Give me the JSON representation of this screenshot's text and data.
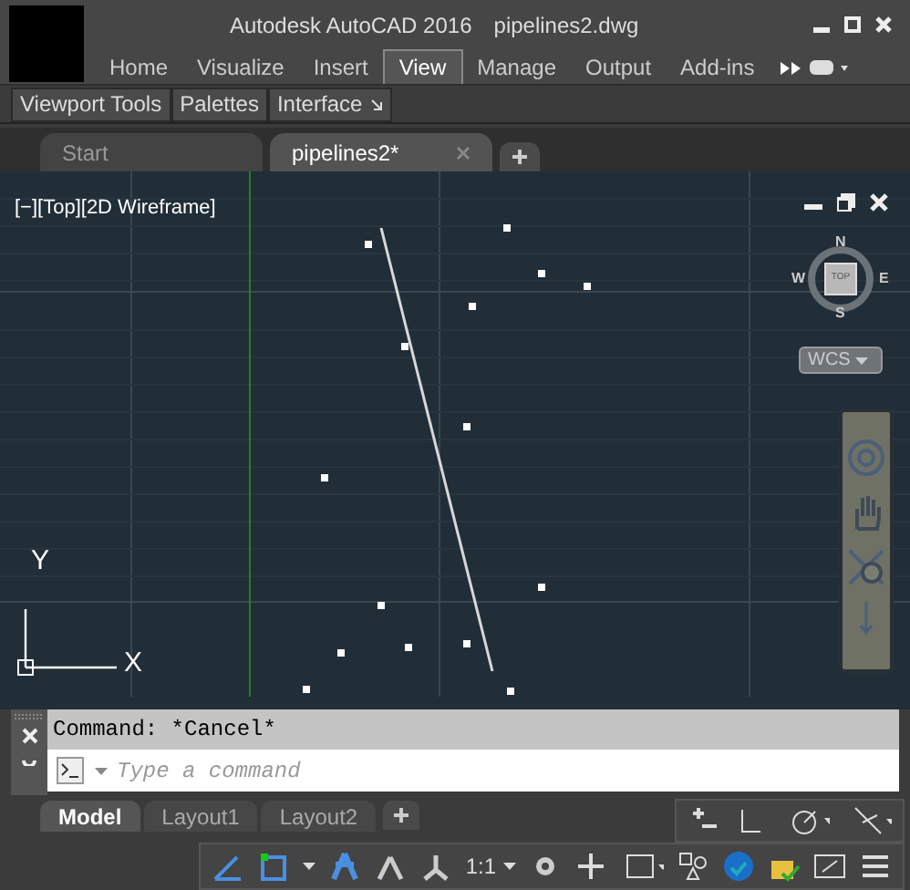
{
  "window": {
    "title": "Autodesk AutoCAD 2016",
    "document": "pipelines2.dwg"
  },
  "ribbon_tabs": [
    {
      "label": "Home",
      "selected": false
    },
    {
      "label": "Visualize",
      "selected": false
    },
    {
      "label": "Insert",
      "selected": false
    },
    {
      "label": "View",
      "selected": true
    },
    {
      "label": "Manage",
      "selected": false
    },
    {
      "label": "Output",
      "selected": false
    },
    {
      "label": "Add-ins",
      "selected": false
    }
  ],
  "ribbon_panels": [
    {
      "label": "Viewport Tools"
    },
    {
      "label": "Palettes"
    },
    {
      "label": "Interface",
      "launcher": true
    }
  ],
  "file_tabs": [
    {
      "label": "Start",
      "selected": false,
      "closable": false
    },
    {
      "label": "pipelines2*",
      "selected": true,
      "closable": true
    }
  ],
  "viewport": {
    "label": "[−][Top][2D Wireframe]",
    "compass": {
      "north": "N",
      "south": "S",
      "east": "E",
      "west": "W",
      "face": "TOP"
    },
    "ucs_menu": "WCS",
    "axis_y": "Y",
    "axis_x": "X"
  },
  "command_line": {
    "history": "Command: *Cancel*",
    "placeholder": "Type a command"
  },
  "layout_tabs": [
    {
      "label": "Model",
      "selected": true
    },
    {
      "label": "Layout1",
      "selected": false
    },
    {
      "label": "Layout2",
      "selected": false
    }
  ],
  "status_bar": {
    "scale": "1:1"
  }
}
